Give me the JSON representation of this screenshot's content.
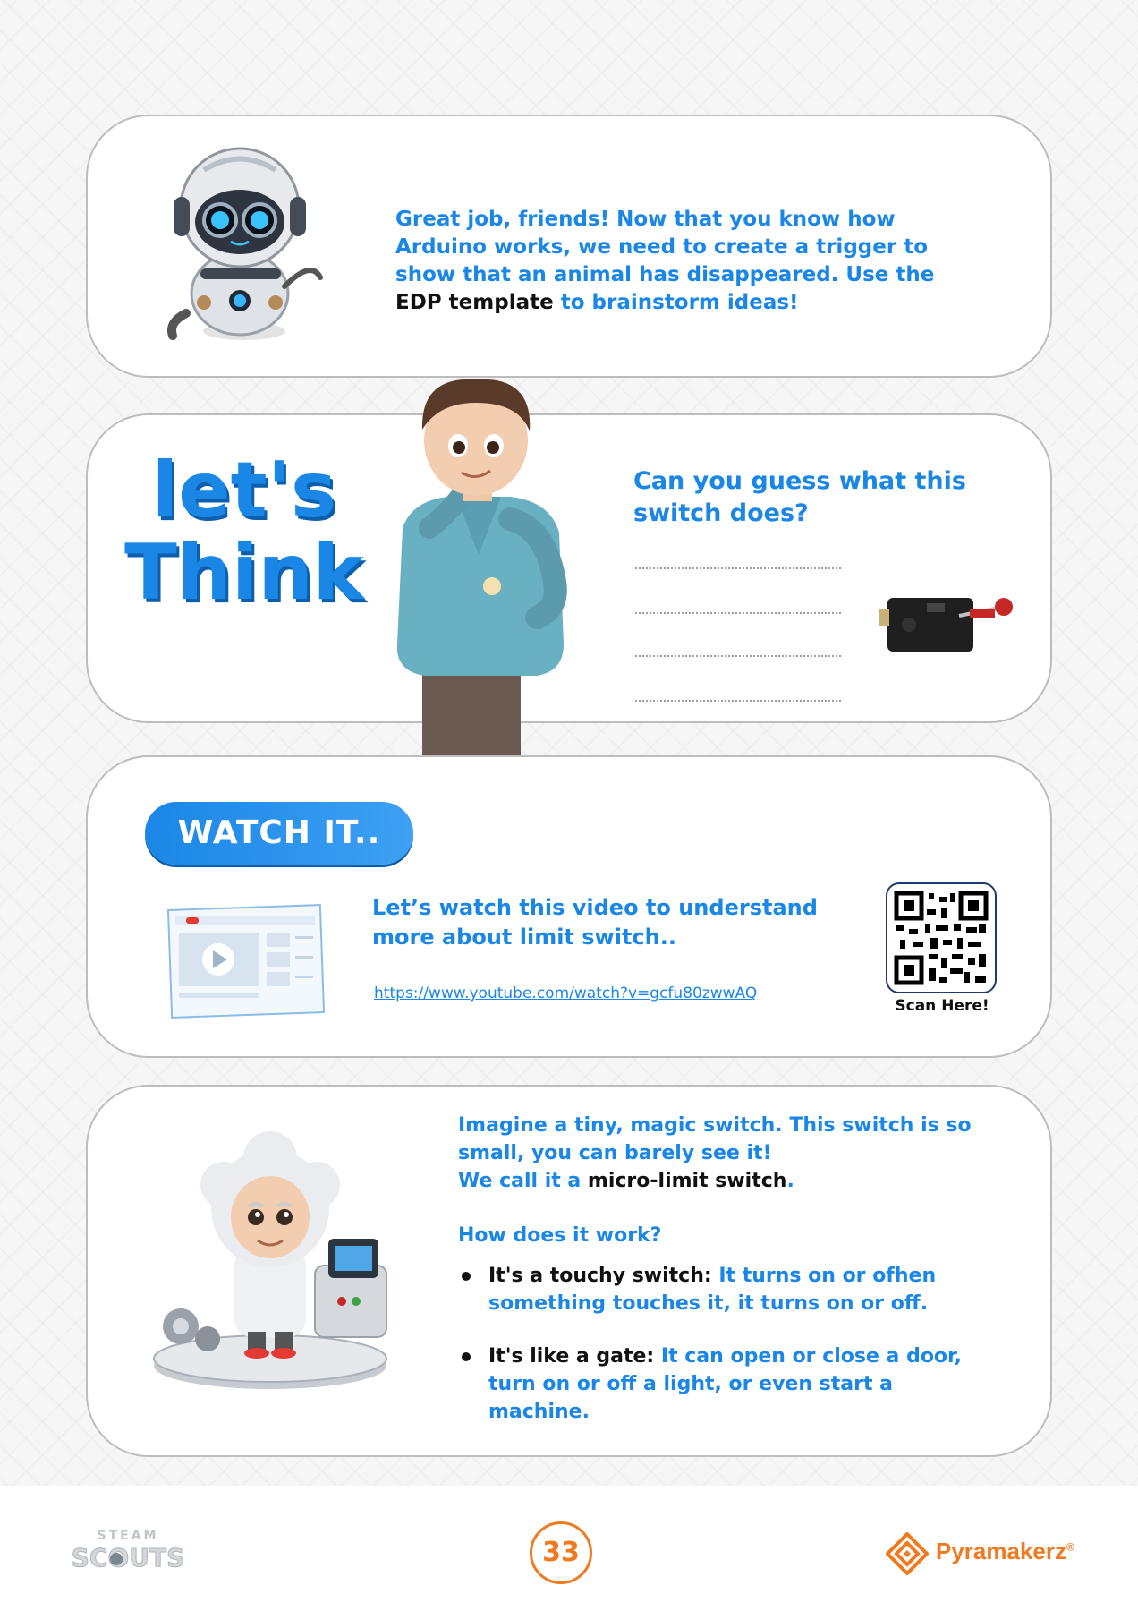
{
  "card1": {
    "text_a": "Great job, friends! Now that you know how Arduino works, we need to create a trigger to show that an animal has disappeared. Use the ",
    "text_b": "EDP template",
    "text_c": " to brainstorm ideas!"
  },
  "card2": {
    "title_line1": "let's",
    "title_line2": "Think",
    "question": "Can you guess what this switch does?"
  },
  "card3": {
    "badge": "WATCH IT..",
    "desc": "Let’s watch this video to understand more about limit switch..",
    "link": "https://www.youtube.com/watch?v=gcfu80zwwAQ",
    "scan_label": "Scan Here!"
  },
  "card4": {
    "intro_a": "Imagine a tiny, magic switch. This switch is so small, you can barely see it!",
    "intro_b": "We call it a ",
    "intro_c": "micro-limit switch",
    "intro_d": ".",
    "how": "How does it work?",
    "b1_bold": "It's a touchy switch:",
    "b1_text": " It turns on or ofhen something touches it, it turns on or off.",
    "b2_bold": "It's like a gate:",
    "b2_text": " It can open or close a door, turn on or off a light, or even start a machine."
  },
  "footer": {
    "steam_top": "STEAM",
    "steam_bottom": "SCOUTS",
    "page_number": "33",
    "brand": "Pyramakerz",
    "brand_mark": "®"
  },
  "colors": {
    "accent_blue": "#1a86e6",
    "accent_orange": "#f07a1f",
    "text_dark": "#111111"
  },
  "icons": [
    "robot-illustration",
    "boy-thinking-illustration",
    "limit-switch-image",
    "video-player-illustration",
    "qr-code",
    "scientist-illustration",
    "steam-scouts-logo",
    "pyramakerz-logo"
  ]
}
